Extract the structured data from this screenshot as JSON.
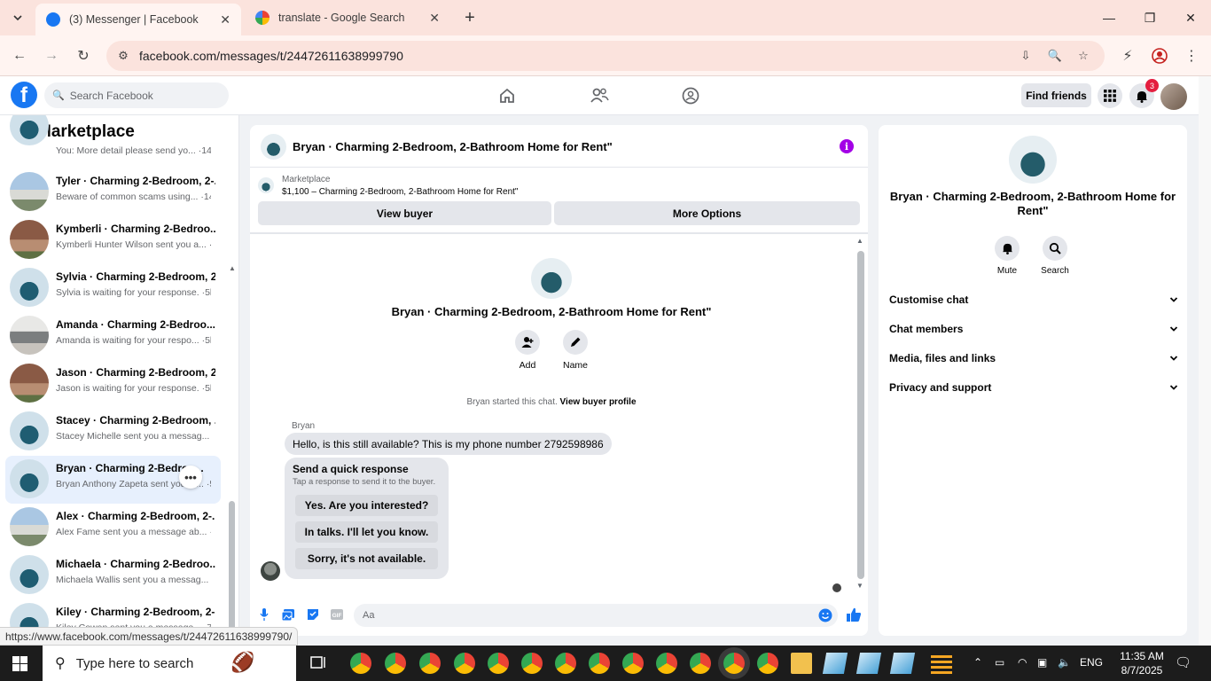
{
  "browser": {
    "tabs": [
      {
        "title": "(3) Messenger | Facebook",
        "active": true
      },
      {
        "title": "translate - Google Search",
        "active": false
      }
    ],
    "url": "facebook.com/messages/t/24472611638999790",
    "hover_url": "https://www.facebook.com/messages/t/24472611638999790/"
  },
  "fb": {
    "search_placeholder": "Search Facebook",
    "find_friends": "Find friends",
    "notification_count": "3"
  },
  "sidebar": {
    "title": "Marketplace",
    "conversations": [
      {
        "name": "",
        "preview": "You: More detail please send yo... ·14m"
      },
      {
        "name": "Tyler · Charming 2-Bedroom, 2-...",
        "preview": "Beware of common scams using... ·14m"
      },
      {
        "name": "Kymberli · Charming 2-Bedroo...",
        "preview": "Kymberli Hunter Wilson sent you a... ·4h"
      },
      {
        "name": "Sylvia · Charming 2-Bedroom, 2...",
        "preview": "Sylvia is waiting for your response. ·5h"
      },
      {
        "name": "Amanda · Charming 2-Bedroo...",
        "preview": "Amanda is waiting for your respo... ·5h"
      },
      {
        "name": "Jason · Charming 2-Bedroom, 2...",
        "preview": "Jason is waiting for your response. ·5h"
      },
      {
        "name": "Stacey · Charming 2-Bedroom, ...",
        "preview": "Stacey Michelle sent you a messag... ·5h"
      },
      {
        "name": "Bryan · Charming 2-Bedroo...",
        "preview": "Bryan Anthony Zapeta sent you a ... ·5h"
      },
      {
        "name": "Alex · Charming 2-Bedroom, 2-...",
        "preview": "Alex Fame sent you a message ab... ·6h"
      },
      {
        "name": "Michaela · Charming 2-Bedroo...",
        "preview": "Michaela Wallis sent you a messag... ·6h"
      },
      {
        "name": "Kiley · Charming 2-Bedroom, 2-...",
        "preview": "Kiley Cowan sent you a message... ·7h"
      }
    ]
  },
  "chat": {
    "title": "Bryan · Charming 2-Bedroom, 2-Bathroom Home for Rent\"",
    "marketplace_label": "Marketplace",
    "listing": "$1,100 – Charming 2-Bedroom, 2-Bathroom Home for Rent\"",
    "view_buyer": "View buyer",
    "more_options": "More Options",
    "add_label": "Add",
    "name_label": "Name",
    "started_text": "Bryan started this chat.",
    "view_buyer_profile": "View buyer profile",
    "sender": "Bryan",
    "message": "Hello, is this still available? This is my phone number 2792598986",
    "quick_title": "Send a quick response",
    "quick_sub": "Tap a response to send it to the buyer.",
    "quick_responses": [
      "Yes. Are you interested?",
      "In talks. I'll let you know.",
      "Sorry, it's not available."
    ],
    "composer_placeholder": "Aa"
  },
  "details": {
    "title": "Bryan · Charming 2-Bedroom, 2-Bathroom Home for Rent\"",
    "mute": "Mute",
    "search": "Search",
    "rows": [
      "Customise chat",
      "Chat members",
      "Media, files and links",
      "Privacy and support"
    ]
  },
  "taskbar": {
    "search_placeholder": "Type here to search",
    "lang": "ENG",
    "time": "11:35 AM",
    "date": "8/7/2025"
  },
  "colors": {
    "fb_blue": "#1877f2",
    "info_purple": "#a300e6",
    "badge_red": "#e41e3f"
  }
}
